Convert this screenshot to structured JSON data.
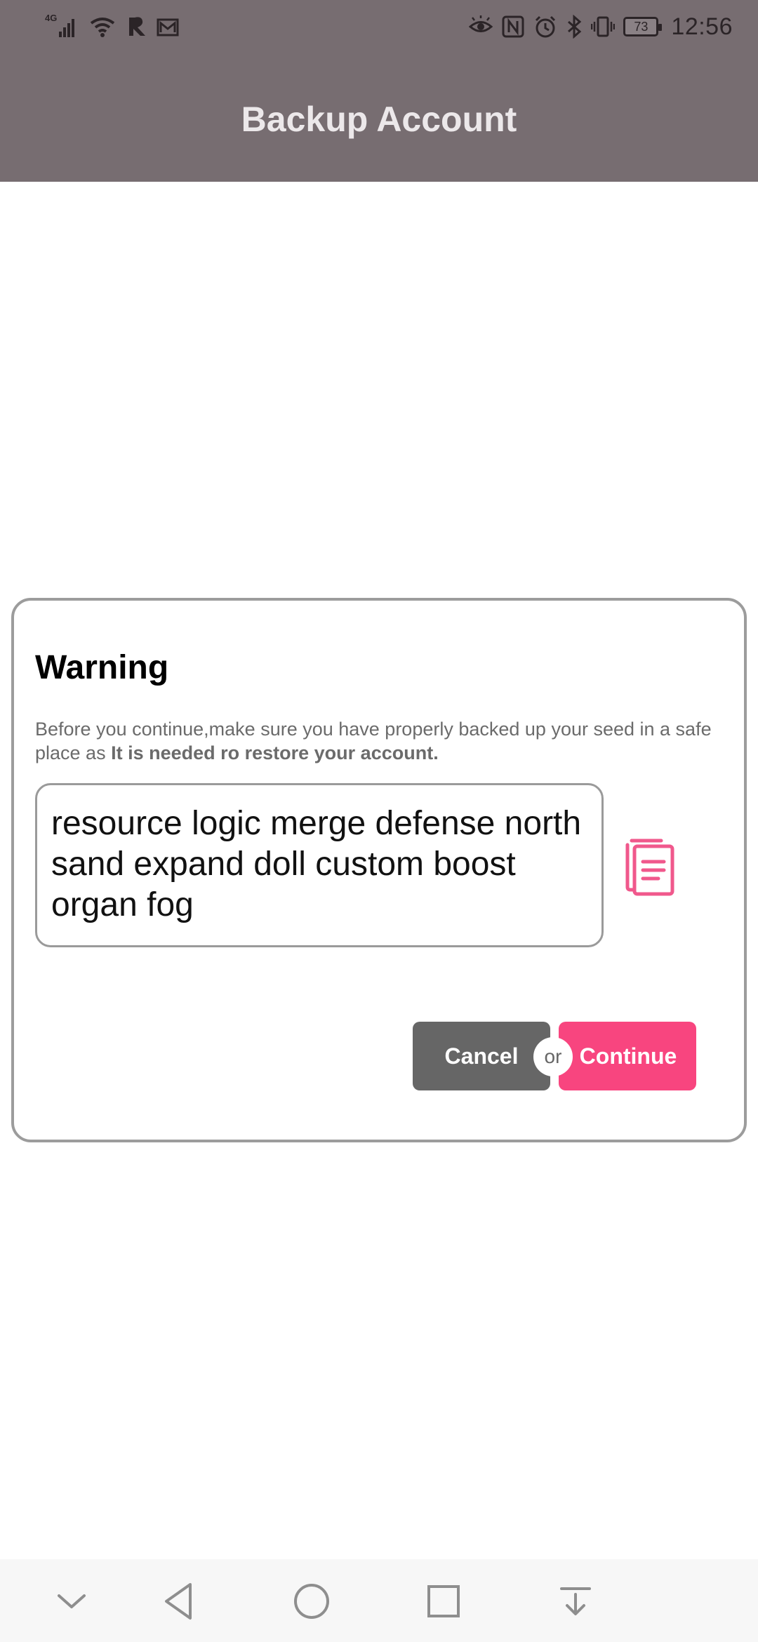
{
  "status_bar": {
    "network_type": "4G",
    "battery_level": "73",
    "time": "12:56",
    "left_icons": [
      "signal-icon",
      "wifi-icon",
      "r-app-icon",
      "mail-icon"
    ],
    "right_icons": [
      "eye-icon",
      "nfc-icon",
      "alarm-icon",
      "bluetooth-icon",
      "vibrate-icon",
      "battery-icon"
    ]
  },
  "header": {
    "title": "Backup Account",
    "background": "#776d71"
  },
  "dialog": {
    "title": "Warning",
    "message_prefix": "Before you continue,make sure you have properly backed up your seed in a safe place as ",
    "message_bold": "It is needed ro restore your account.",
    "seed_phrase": "resource logic merge defense north sand expand doll custom boost organ fog",
    "copy_icon": "copy-icon",
    "cancel_label": "Cancel",
    "or_label": "or",
    "continue_label": "Continue",
    "accent_color": "#f8457f",
    "cancel_color": "#666666"
  },
  "nav_bar": {
    "buttons": [
      "chevron-down-icon",
      "back-icon",
      "home-icon",
      "recents-icon",
      "notification-pull-icon"
    ]
  }
}
